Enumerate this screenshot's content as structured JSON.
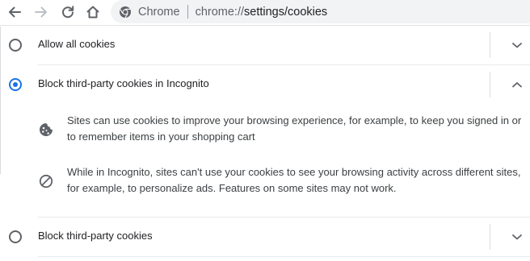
{
  "omnibox": {
    "site_label": "Chrome",
    "url_scheme": "chrome://",
    "url_path": "settings/cookies"
  },
  "options": [
    {
      "label": "Allow all cookies",
      "selected": false,
      "expanded": false
    },
    {
      "label": "Block third-party cookies in Incognito",
      "selected": true,
      "expanded": true,
      "details": [
        {
          "icon": "cookie-icon",
          "text": "Sites can use cookies to improve your browsing experience, for example, to keep you signed in or to remember items in your shopping cart"
        },
        {
          "icon": "block-icon",
          "text": "While in Incognito, sites can't use your cookies to see your browsing activity across different sites, for example, to personalize ads. Features on some sites may not work."
        }
      ]
    },
    {
      "label": "Block third-party cookies",
      "selected": false,
      "expanded": false
    }
  ],
  "colors": {
    "accent": "#1a73e8",
    "icon": "#5f6368",
    "text": "#202124",
    "omnibox_bg": "#f1f3f4"
  }
}
